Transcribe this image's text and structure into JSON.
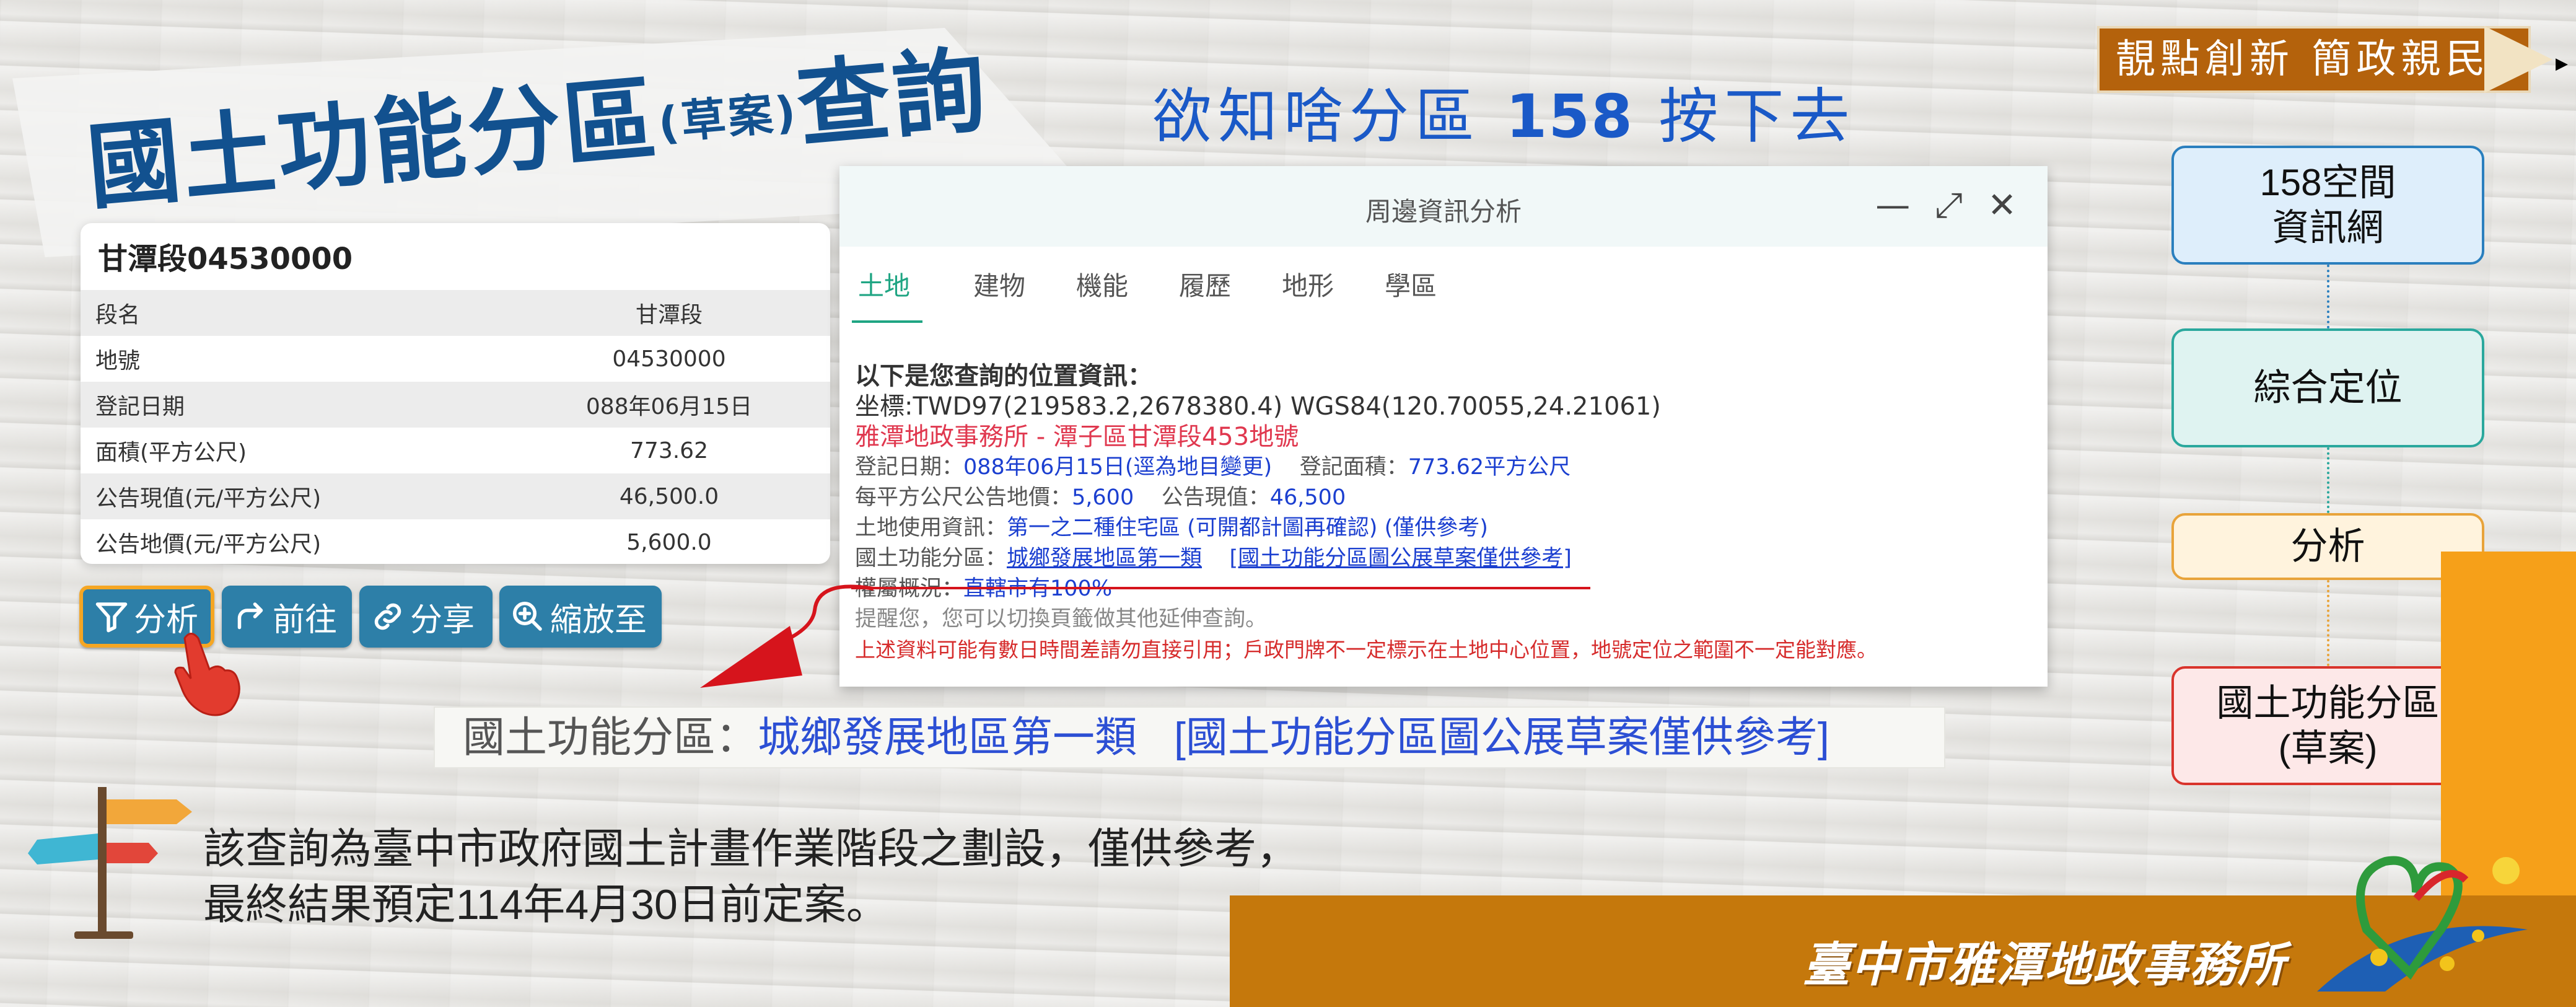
{
  "title": {
    "main_before": "國土功能分區",
    "main_small": "(草案)",
    "main_after": "查詢"
  },
  "slogan": {
    "prefix": "欲知啥分區",
    "number": "158",
    "suffix": "按下去"
  },
  "motto": "靚點創新 簡政親民",
  "flow": {
    "step1": "158空間\n資訊網",
    "step2": "綜合定位",
    "step3": "分析",
    "step4": "國土功能分區\n(草案)"
  },
  "land_card": {
    "title": "甘潭段04530000",
    "rows": [
      {
        "key": "段名",
        "value": "甘潭段"
      },
      {
        "key": "地號",
        "value": "04530000"
      },
      {
        "key": "登記日期",
        "value": "088年06月15日"
      },
      {
        "key": "面積(平方公尺)",
        "value": "773.62"
      },
      {
        "key": "公告現值(元/平方公尺)",
        "value": "46,500.0"
      },
      {
        "key": "公告地價(元/平方公尺)",
        "value": "5,600.0"
      }
    ]
  },
  "toolbar": {
    "analyze": "分析",
    "goto": "前往",
    "share": "分享",
    "zoom": "縮放至"
  },
  "panel": {
    "title": "周邊資訊分析",
    "tabs": [
      "土地",
      "建物",
      "機能",
      "履歷",
      "地形",
      "學區"
    ],
    "heading": "以下是您查詢的位置資訊：",
    "coord": "坐標:TWD97(219583.2,2678380.4) WGS84(120.70055,24.21061)",
    "office_line": "雅潭地政事務所 - 潭子區甘潭段453地號",
    "reg_date_label": "登記日期：",
    "reg_date_value": "088年06月15日(逕為地目變更)",
    "reg_area_label": "登記面積：",
    "reg_area_value": "773.62平方公尺",
    "land_price_label": "每平方公尺公告地價：",
    "land_price_value": "5,600",
    "present_value_label": "公告現值：",
    "present_value_value": "46,500",
    "land_use_label": "土地使用資訊：",
    "land_use_value": "第一之二種住宅區 (可開都計圖再確認) (僅供參考)",
    "zone_label": "國土功能分區：",
    "zone_value": "城鄉發展地區第一類",
    "zone_link": "[國土功能分區圖公展草案僅供參考]",
    "ownership_label": "權屬概況：",
    "ownership_value": "直轄市有100%",
    "reminder": "提醒您，您可以切換頁籤做其他延伸查詢。",
    "warning": "上述資料可能有數日時間差請勿直接引用；戶政門牌不一定標示在土地中心位置，地號定位之範圍不一定能對應。"
  },
  "zone_strip": {
    "label": "國土功能分區：",
    "value": "城鄉發展地區第一類",
    "link": "[國土功能分區圖公展草案僅供參考]"
  },
  "note": {
    "line1": "該查詢為臺中市政府國土計畫作業階段之劃設，僅供參考，",
    "line2": "最終結果預定114年4月30日前定案。"
  },
  "office_name": "臺中市雅潭地政事務所",
  "colors": {
    "title_blue": "#12518f",
    "slogan_blue": "#1a59c7",
    "motto_brown": "#b4620c",
    "bottom_bar": "#c5780c",
    "accent_orange": "#f6a019",
    "tab_active": "#1fa583",
    "button_blue": "#2d7fa8"
  },
  "icons": {
    "filter": "filter-icon",
    "goto": "arrow-redo-icon",
    "share": "link-icon",
    "zoom": "zoom-in-icon",
    "hand": "pointing-hand-icon",
    "minimize": "minimize-icon",
    "maximize": "maximize-icon",
    "close": "close-icon"
  }
}
